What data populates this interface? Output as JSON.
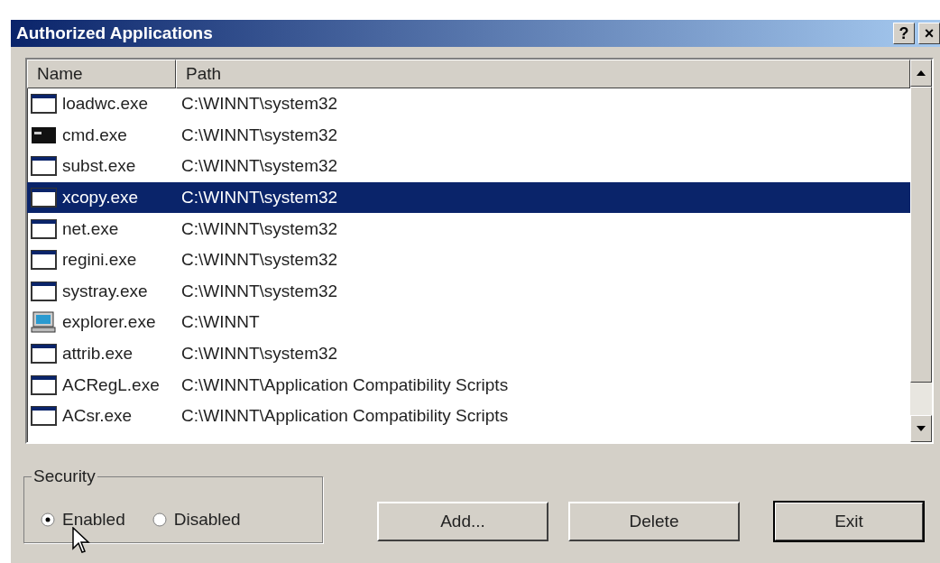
{
  "window": {
    "title": "Authorized Applications",
    "buttons": [
      "?",
      "×"
    ]
  },
  "list": {
    "columns": [
      "Name",
      "Path"
    ],
    "rows": [
      {
        "kind": "window",
        "name": "loadwc.exe",
        "path": "C:\\WINNT\\system32",
        "selected": false
      },
      {
        "kind": "console",
        "name": "cmd.exe",
        "path": "C:\\WINNT\\system32",
        "selected": false
      },
      {
        "kind": "window",
        "name": "subst.exe",
        "path": "C:\\WINNT\\system32",
        "selected": false
      },
      {
        "kind": "window",
        "name": "xcopy.exe",
        "path": "C:\\WINNT\\system32",
        "selected": true
      },
      {
        "kind": "window",
        "name": "net.exe",
        "path": "C:\\WINNT\\system32",
        "selected": false
      },
      {
        "kind": "window",
        "name": "regini.exe",
        "path": "C:\\WINNT\\system32",
        "selected": false
      },
      {
        "kind": "window",
        "name": "systray.exe",
        "path": "C:\\WINNT\\system32",
        "selected": false
      },
      {
        "kind": "computer",
        "name": "explorer.exe",
        "path": "C:\\WINNT",
        "selected": false
      },
      {
        "kind": "window",
        "name": "attrib.exe",
        "path": "C:\\WINNT\\system32",
        "selected": false
      },
      {
        "kind": "window",
        "name": "ACRegL.exe",
        "path": "C:\\WINNT\\Application Compatibility Scripts",
        "selected": false
      },
      {
        "kind": "window",
        "name": "ACsr.exe",
        "path": "C:\\WINNT\\Application Compatibility Scripts",
        "selected": false
      }
    ]
  },
  "security": {
    "label": "Security",
    "options": [
      {
        "label": "Enabled",
        "selected": true
      },
      {
        "label": "Disabled",
        "selected": false
      }
    ]
  },
  "buttons": [
    {
      "label": "Add...",
      "default": false
    },
    {
      "label": "Delete",
      "default": false
    },
    {
      "label": "Exit",
      "default": true
    }
  ]
}
